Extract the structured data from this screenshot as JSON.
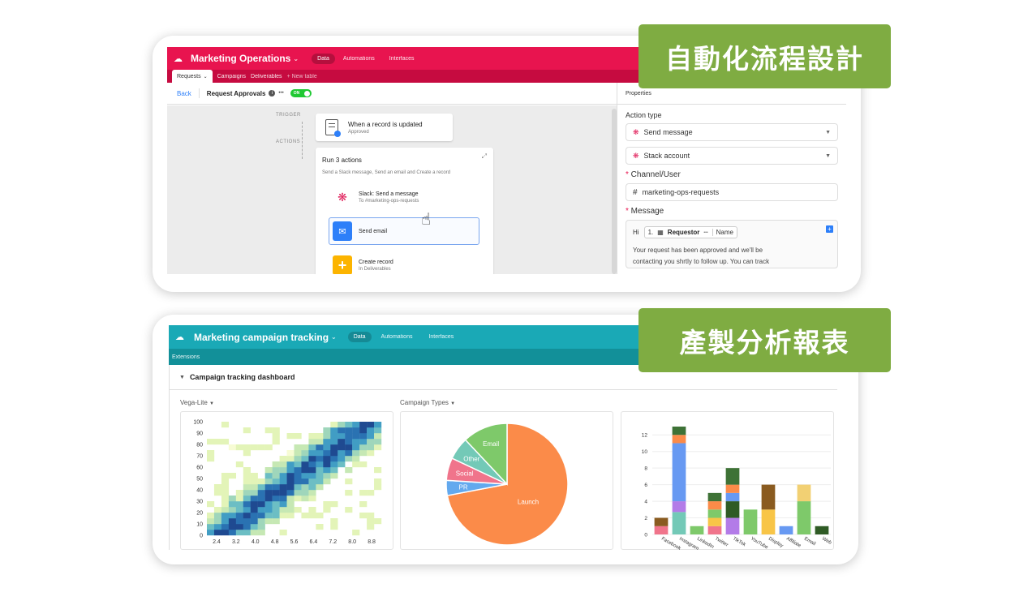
{
  "tags": {
    "automation": "自動化流程設計",
    "reporting": "產製分析報表"
  },
  "top": {
    "title": "Marketing Operations",
    "nav": [
      "Data",
      "Automations",
      "Interfaces"
    ],
    "tables": [
      "Requests",
      "Campaigns",
      "Deliverables"
    ],
    "new_table": "New table",
    "back": "Back",
    "automation_name": "Request Approvals",
    "toggle": "ON",
    "more": "•••",
    "trigger_label": "TRIGGER",
    "actions_label": "ACTIONS",
    "trigger": {
      "title": "When a record is updated",
      "subtitle": "Approved"
    },
    "run": {
      "title": "Run 3 actions",
      "desc": "Send a Slack message, Send an email and Create a record"
    },
    "actions": [
      {
        "title": "Slack: Send a message",
        "subtitle": "To #marketing-ops-requests"
      },
      {
        "title": "Send email",
        "subtitle": ""
      },
      {
        "title": "Create record",
        "subtitle": "In Deliverables"
      }
    ],
    "properties": {
      "header": "Properties",
      "action_type_label": "Action type",
      "action_type": "Send message",
      "account": "Stack account",
      "channel_label": "Channel/User",
      "channel": "marketing-ops-requests",
      "message_label": "Message",
      "message": {
        "hi": "Hi",
        "num": "1.",
        "field": "Requestor",
        "dots": "•••",
        "name": "Name",
        "line1": "Your request has been approved and we'll be",
        "line2": "contacting you shrtly to follow up. You can track"
      }
    }
  },
  "bottom": {
    "title": "Marketing campaign tracking",
    "nav": [
      "Data",
      "Automations",
      "Interfaces"
    ],
    "extensions": "Extensions",
    "dashboard": "Campaign tracking dashboard",
    "panel1": "Vega-Lite",
    "panel2": "Campaign Types"
  },
  "colors": {
    "top_header": "#e8144f",
    "top_sub": "#c60b40",
    "bottom_header": "#1aa9b6",
    "bottom_sub": "#129099",
    "tag": "#7fac42"
  },
  "chart_data": [
    {
      "type": "heatmap",
      "title": "",
      "x_ticks": [
        "2.4",
        "3.2",
        "4.0",
        "4.8",
        "5.6",
        "6.4",
        "7.2",
        "8.0",
        "8.8"
      ],
      "y_ticks": [
        "0",
        "10",
        "20",
        "30",
        "40",
        "50",
        "60",
        "70",
        "80",
        "90",
        "100"
      ],
      "xlim": [
        2,
        9.2
      ],
      "ylim": [
        0,
        100
      ],
      "density_trend": "density concentrated along a diagonal band from low x/low y to high x/high y"
    },
    {
      "type": "pie",
      "slices": [
        {
          "label": "Launch",
          "value": 72,
          "color": "#fb8b49"
        },
        {
          "label": "PR",
          "value": 4,
          "color": "#63a9ee"
        },
        {
          "label": "Social",
          "value": 6,
          "color": "#f0748b"
        },
        {
          "label": "Other",
          "value": 6,
          "color": "#73c9b7"
        },
        {
          "label": "Email",
          "value": 12,
          "color": "#7ec96a"
        }
      ]
    },
    {
      "type": "bar",
      "stacked": true,
      "categories": [
        "Facebook",
        "Instagram",
        "LinkedIn",
        "Twitter",
        "TikTok",
        "YouTube",
        "Display",
        "Affiliate",
        "Email",
        "Web"
      ],
      "y_ticks": [
        "0",
        "2",
        "4",
        "6",
        "8",
        "10",
        "12"
      ],
      "ylim": [
        0,
        13
      ],
      "series": [
        {
          "color": "#f0748b",
          "values": [
            1,
            0,
            0,
            1,
            0,
            0,
            0,
            0,
            0,
            0
          ]
        },
        {
          "color": "#73c9b7",
          "values": [
            0,
            2.7,
            0,
            0,
            0,
            0,
            0,
            0,
            0,
            0
          ]
        },
        {
          "color": "#b37be8",
          "values": [
            0,
            1.3,
            0,
            0,
            2,
            0,
            0,
            0,
            0,
            0
          ]
        },
        {
          "color": "#f8c547",
          "values": [
            0,
            0,
            0,
            1,
            0,
            0,
            3,
            0,
            0,
            0
          ]
        },
        {
          "color": "#7ec96a",
          "values": [
            0,
            0,
            1,
            1,
            0,
            3,
            0,
            0,
            4,
            0
          ]
        },
        {
          "color": "#2f5b25",
          "values": [
            0,
            0,
            0,
            0,
            2,
            0,
            0,
            0,
            0,
            1
          ]
        },
        {
          "color": "#6799f2",
          "values": [
            0,
            7,
            0,
            0,
            1,
            0,
            0,
            1,
            0,
            0
          ]
        },
        {
          "color": "#fb8b49",
          "values": [
            0,
            1,
            0,
            1,
            1,
            0,
            0,
            0,
            0,
            0
          ]
        },
        {
          "color": "#8a5b20",
          "values": [
            1,
            0,
            0,
            0,
            0,
            0,
            3,
            0,
            0,
            0
          ]
        },
        {
          "color": "#3e7236",
          "values": [
            0,
            1,
            0,
            1,
            2,
            0,
            0,
            0,
            0,
            0
          ]
        },
        {
          "color": "#f2d073",
          "values": [
            0,
            0,
            0,
            0,
            0,
            0,
            0,
            0,
            2,
            0
          ]
        }
      ]
    }
  ]
}
